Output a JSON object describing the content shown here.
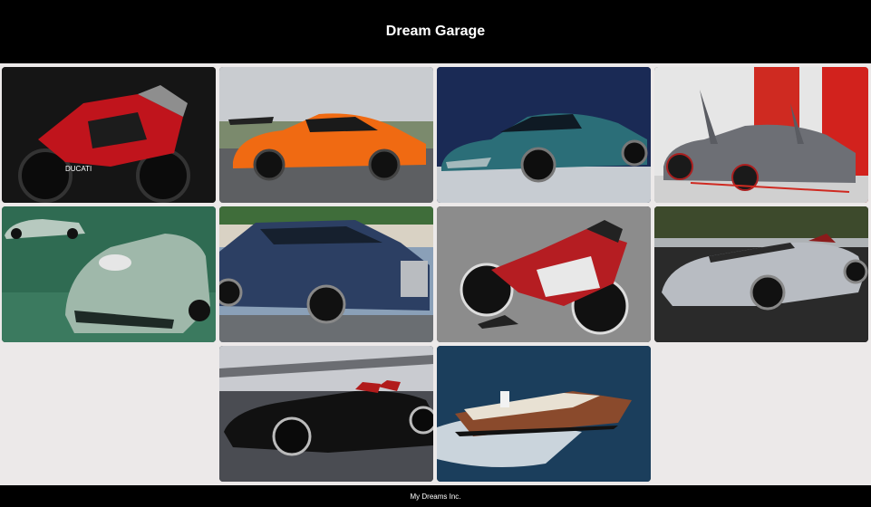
{
  "header": {
    "title": "Dream Garage"
  },
  "gallery": {
    "items": [
      {
        "name": "ducati-superleggera-image",
        "body": "#c0141c",
        "bg": "#151515"
      },
      {
        "name": "koenigsegg-jesko-image",
        "body": "#f06a12",
        "bg": "#c9ccd0"
      },
      {
        "name": "aston-martin-valhalla-image",
        "body": "#2b6e78",
        "bg": "#1a2a55"
      },
      {
        "name": "lamborghini-veneno-image",
        "body": "#6d6f75",
        "bg": "#e6e6e6"
      },
      {
        "name": "aston-martin-v12-speedster-image",
        "body": "#9fb8aa",
        "bg": "#2f6b52"
      },
      {
        "name": "bentley-flying-spur-image",
        "body": "#2c3f63",
        "bg": "#8aa0b8"
      },
      {
        "name": "mv-agusta-superveloce-image",
        "body": "#b51d22",
        "bg": "#8c8c8c"
      },
      {
        "name": "ferrari-monza-sp1-image",
        "body": "#b8bcc2",
        "bg": "#2a2a2a"
      },
      {
        "name": "ferrari-monza-sp2-black-image",
        "body": "#111111",
        "bg": "#4a4c52"
      },
      {
        "name": "riva-speedboat-image",
        "body": "#8a4a2c",
        "bg": "#1b3e5c"
      }
    ]
  },
  "footer": {
    "text": "My Dreams Inc."
  }
}
